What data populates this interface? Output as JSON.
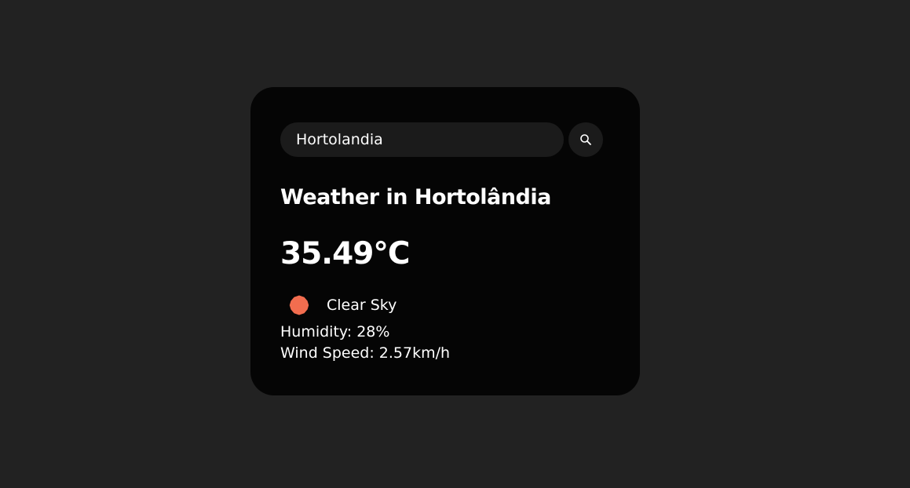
{
  "search": {
    "value": "Hortolandia",
    "icon": "search-icon"
  },
  "weather": {
    "title": "Weather in Hortolândia",
    "temperature": "35.49°C",
    "condition": "Clear Sky",
    "condition_icon": "sun-icon",
    "condition_icon_color": "#f26d4f",
    "humidity": "Humidity: 28%",
    "wind_speed": "Wind Speed: 2.57km/h"
  },
  "colors": {
    "background": "#222222",
    "card": "#050505",
    "input": "#1b1b1b",
    "text": "#ffffff"
  }
}
